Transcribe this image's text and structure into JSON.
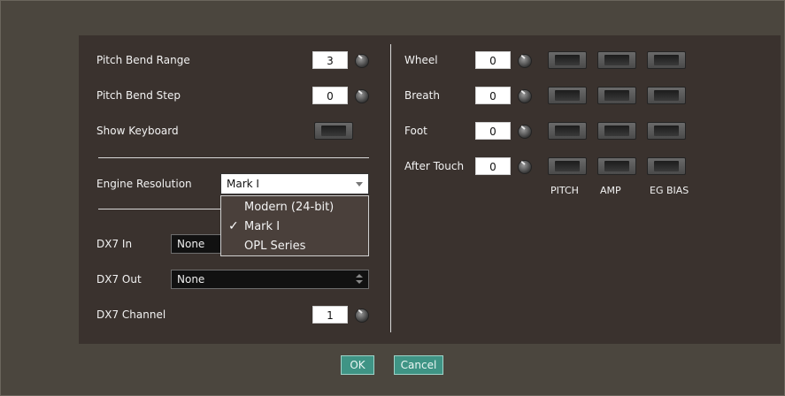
{
  "settings": {
    "pitch_bend_range": {
      "label": "Pitch Bend Range",
      "value": "3"
    },
    "pitch_bend_step": {
      "label": "Pitch Bend Step",
      "value": "0"
    },
    "show_keyboard": {
      "label": "Show Keyboard"
    },
    "engine_resolution": {
      "label": "Engine Resolution",
      "selected": "Mark I",
      "options": [
        "Modern (24-bit)",
        "Mark I",
        "OPL Series"
      ],
      "check_mark": "✓"
    },
    "dx7_in": {
      "label": "DX7 In",
      "value": "None"
    },
    "dx7_out": {
      "label": "DX7 Out",
      "value": "None"
    },
    "dx7_channel": {
      "label": "DX7 Channel",
      "value": "1"
    }
  },
  "controllers": {
    "rows": [
      {
        "label": "Wheel",
        "value": "0"
      },
      {
        "label": "Breath",
        "value": "0"
      },
      {
        "label": "Foot",
        "value": "0"
      },
      {
        "label": "After Touch",
        "value": "0"
      }
    ],
    "columns": [
      "PITCH",
      "AMP",
      "EG BIAS"
    ]
  },
  "buttons": {
    "ok": "OK",
    "cancel": "Cancel"
  },
  "colors": {
    "background": "#4b463e",
    "panel": "#3a322e",
    "button": "#3f9485"
  }
}
